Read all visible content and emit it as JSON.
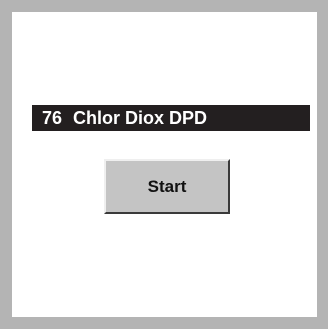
{
  "method": {
    "number": "76",
    "name": "Chlor Diox DPD"
  },
  "actions": {
    "start_label": "Start"
  },
  "colors": {
    "frame": "#b4b4b4",
    "background": "#ffffff",
    "method_bar": "#231f20",
    "method_text": "#ffffff",
    "button_face": "#c4c4c4"
  }
}
